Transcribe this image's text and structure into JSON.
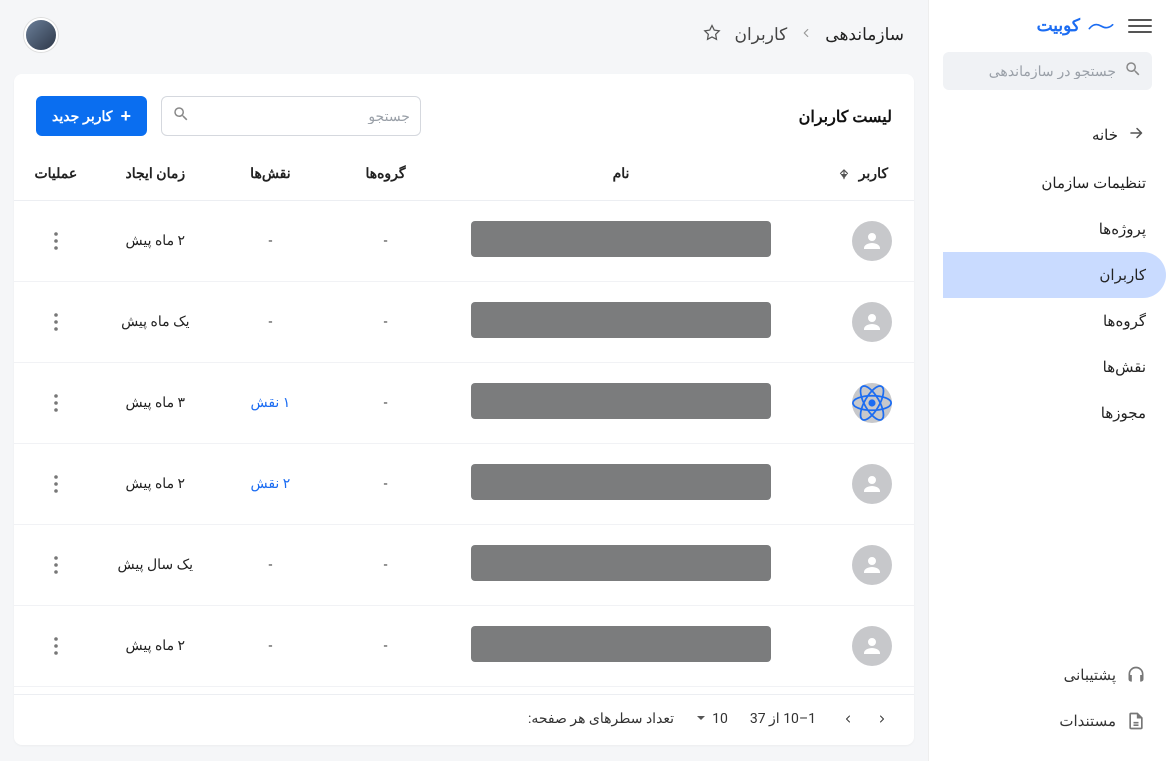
{
  "brand": {
    "name": "کوبیت"
  },
  "sidebar": {
    "search_placeholder": "جستجو در سازماندهی",
    "items": [
      {
        "label": "خانه",
        "kind": "home"
      },
      {
        "label": "تنظیمات سازمان"
      },
      {
        "label": "پروژه‌ها"
      },
      {
        "label": "کاربران",
        "active": true
      },
      {
        "label": "گروه‌ها"
      },
      {
        "label": "نقش‌ها"
      },
      {
        "label": "مجوزها"
      }
    ],
    "bottom": [
      {
        "label": "پشتیبانی",
        "icon": "support"
      },
      {
        "label": "مستندات",
        "icon": "doc"
      }
    ]
  },
  "breadcrumb": {
    "org": "سازماندهی",
    "page": "کاربران"
  },
  "card": {
    "title": "لیست کاربران",
    "search_placeholder": "جستجو",
    "new_button": "کاربر جدید"
  },
  "columns": {
    "user": "کاربر",
    "name": "نام",
    "groups": "گروه‌ها",
    "roles": "نقش‌ها",
    "created": "زمان ایجاد",
    "actions": "عملیات"
  },
  "rows": [
    {
      "avatar": "person",
      "groups": "-",
      "roles": "-",
      "role_link": false,
      "created": "۲ ماه پیش"
    },
    {
      "avatar": "person",
      "groups": "-",
      "roles": "-",
      "role_link": false,
      "created": "یک ماه پیش"
    },
    {
      "avatar": "react",
      "groups": "-",
      "roles": "۱ نقش",
      "role_link": true,
      "created": "۳ ماه پیش"
    },
    {
      "avatar": "person",
      "groups": "-",
      "roles": "۲ نقش",
      "role_link": true,
      "created": "۲ ماه پیش"
    },
    {
      "avatar": "person",
      "groups": "-",
      "roles": "-",
      "role_link": false,
      "created": "یک سال پیش"
    },
    {
      "avatar": "person",
      "groups": "-",
      "roles": "-",
      "role_link": false,
      "created": "۲ ماه پیش"
    }
  ],
  "pagination": {
    "rows_label": "تعداد سطرهای هر صفحه:",
    "page_size": "10",
    "range": "1–10 از 37"
  }
}
